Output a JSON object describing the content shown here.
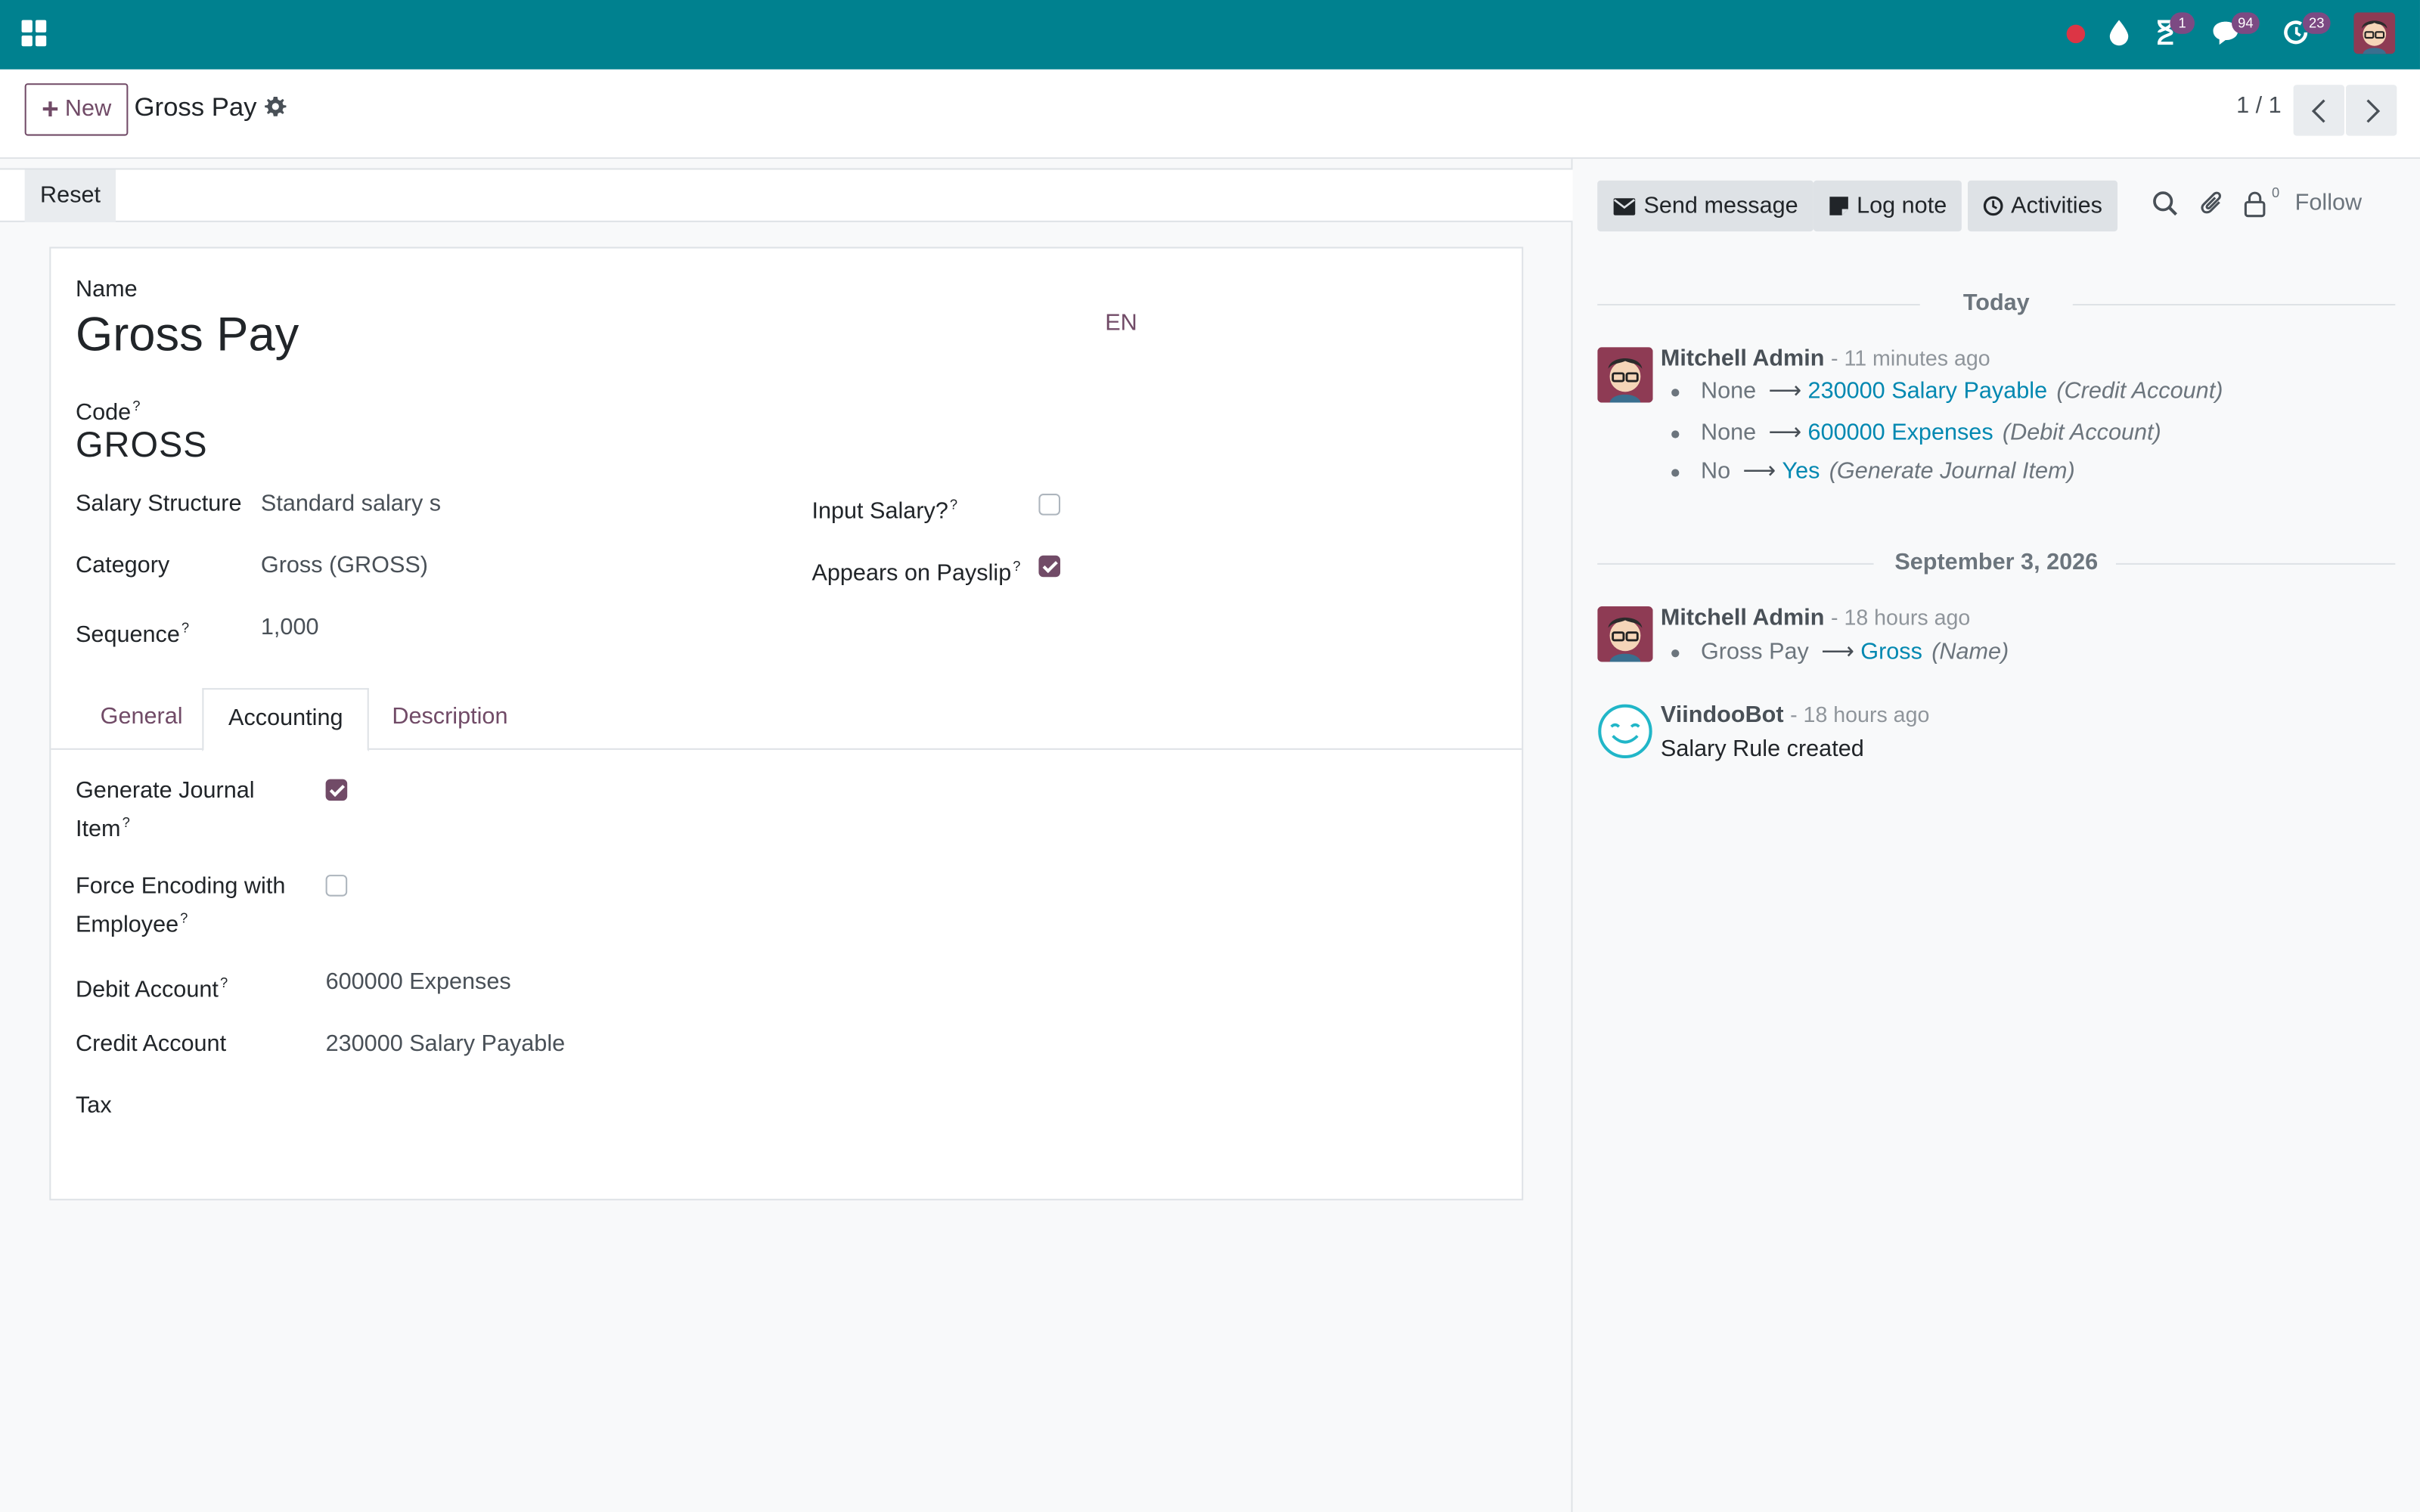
{
  "navbar": {
    "badges": {
      "activities": "1",
      "messages": "94",
      "updates": "23"
    },
    "colors": {
      "bar": "#00818f",
      "badge": "#7c4a83",
      "recording": "#dc3545"
    },
    "icons": [
      "apps-grid-icon",
      "recording-dot-icon",
      "droplet-icon",
      "hourglass-icon",
      "chat-icon",
      "refresh-clock-icon",
      "user-avatar"
    ]
  },
  "control_panel": {
    "new_button": "New",
    "record_title": "Gross Pay",
    "pager": "1 / 1"
  },
  "status_bar": {
    "reset_button": "Reset"
  },
  "form": {
    "name_label": "Name",
    "name_value": "Gross Pay",
    "lang": "EN",
    "code_label": "Code",
    "code_value": "GROSS",
    "help_mark": "?",
    "salary_structure_label": "Salary Structure",
    "salary_structure_value": "Standard salary s",
    "category_label": "Category",
    "category_value": "Gross (GROSS)",
    "sequence_label": "Sequence",
    "sequence_value": "1,000",
    "input_salary_label": "Input Salary?",
    "input_salary_checked": false,
    "appears_on_payslip_label": "Appears on Payslip",
    "appears_on_payslip_checked": true
  },
  "tabs": [
    {
      "label": "General",
      "active": false
    },
    {
      "label": "Accounting",
      "active": true
    },
    {
      "label": "Description",
      "active": false
    }
  ],
  "accounting": {
    "generate_journal_label_1": "Generate Journal",
    "generate_journal_label_2": "Item",
    "generate_journal_checked": true,
    "force_encoding_label_1": "Force Encoding with",
    "force_encoding_label_2": "Employee",
    "force_encoding_checked": false,
    "debit_account_label": "Debit Account",
    "debit_account_value": "600000 Expenses",
    "credit_account_label": "Credit Account",
    "credit_account_value": "230000 Salary Payable",
    "tax_label": "Tax"
  },
  "chatter": {
    "send_message": "Send message",
    "log_note": "Log note",
    "activities": "Activities",
    "follower_count": "0",
    "follow": "Follow",
    "groups": [
      {
        "date": "Today",
        "messages": [
          {
            "author": "Mitchell Admin",
            "time": "- 11 minutes ago",
            "tracking": [
              {
                "old": "None",
                "new": "230000 Salary Payable",
                "field": "(Credit Account)"
              },
              {
                "old": "None",
                "new": "600000 Expenses",
                "field": "(Debit Account)"
              },
              {
                "old": "No",
                "new": "Yes",
                "field": "(Generate Journal Item)"
              }
            ]
          }
        ]
      },
      {
        "date": "September 3, 2026",
        "messages": [
          {
            "author": "Mitchell Admin",
            "time": "- 18 hours ago",
            "tracking": [
              {
                "old": "Gross Pay",
                "new": "Gross",
                "field": "(Name)"
              }
            ]
          },
          {
            "author": "ViindooBot",
            "time": "- 18 hours ago",
            "body": "Salary Rule created"
          }
        ]
      }
    ],
    "arrow": "⟶"
  }
}
